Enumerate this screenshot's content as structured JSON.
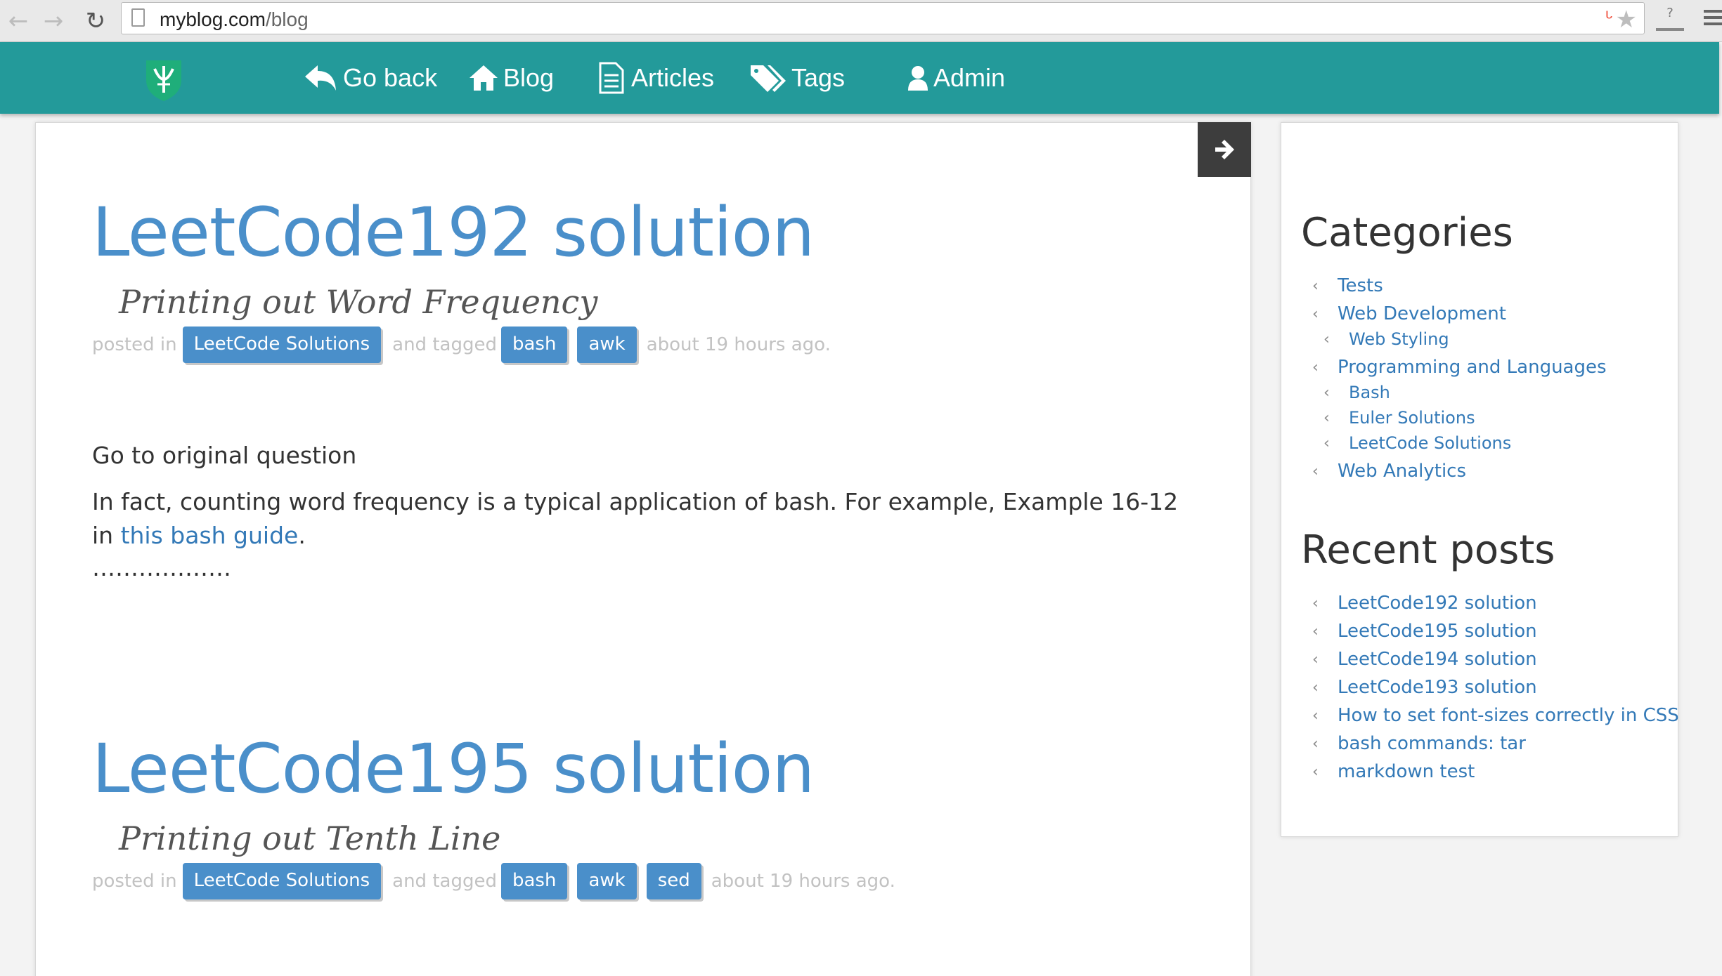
{
  "browser": {
    "url_host": "myblog.com",
    "url_path": "/blog"
  },
  "nav": {
    "items": [
      {
        "label": "Go back",
        "icon": "reply-icon"
      },
      {
        "label": "Blog",
        "icon": "home-icon"
      },
      {
        "label": "Articles",
        "icon": "document-icon"
      },
      {
        "label": "Tags",
        "icon": "tags-icon"
      },
      {
        "label": "Admin",
        "icon": "user-icon"
      }
    ]
  },
  "posts": [
    {
      "title": "LeetCode192 solution",
      "subtitle": "Printing out Word Frequency",
      "posted_in_label": "posted in",
      "category": "LeetCode Solutions",
      "tagged_label": "and tagged",
      "tags": [
        "bash",
        "awk"
      ],
      "time": "about 19 hours ago.",
      "link_text": "Go to original question",
      "body_before": "In fact, counting word frequency is a typical application of bash. For example, Example 16-12 in ",
      "body_link": "this bash guide",
      "body_after": ".",
      "ellipsis": "………………"
    },
    {
      "title": "LeetCode195 solution",
      "subtitle": "Printing out Tenth Line",
      "posted_in_label": "posted in",
      "category": "LeetCode Solutions",
      "tagged_label": "and tagged",
      "tags": [
        "bash",
        "awk",
        "sed"
      ],
      "time": "about 19 hours ago."
    }
  ],
  "sidebar": {
    "categories_title": "Categories",
    "categories": [
      {
        "label": "Tests",
        "level": 0
      },
      {
        "label": "Web Development",
        "level": 0
      },
      {
        "label": "Web Styling",
        "level": 1
      },
      {
        "label": "Programming and Languages",
        "level": 0
      },
      {
        "label": "Bash",
        "level": 1
      },
      {
        "label": "Euler Solutions",
        "level": 1
      },
      {
        "label": "LeetCode Solutions",
        "level": 1
      },
      {
        "label": "Web Analytics",
        "level": 0
      }
    ],
    "recent_title": "Recent posts",
    "recent": [
      "LeetCode192 solution",
      "LeetCode195 solution",
      "LeetCode194 solution",
      "LeetCode193 solution",
      "How to set font-sizes correctly in CSS",
      "bash commands: tar",
      "markdown test"
    ]
  },
  "colors": {
    "nav_bg": "#239a9a",
    "accent": "#4a8fca",
    "link": "#3379b7"
  }
}
